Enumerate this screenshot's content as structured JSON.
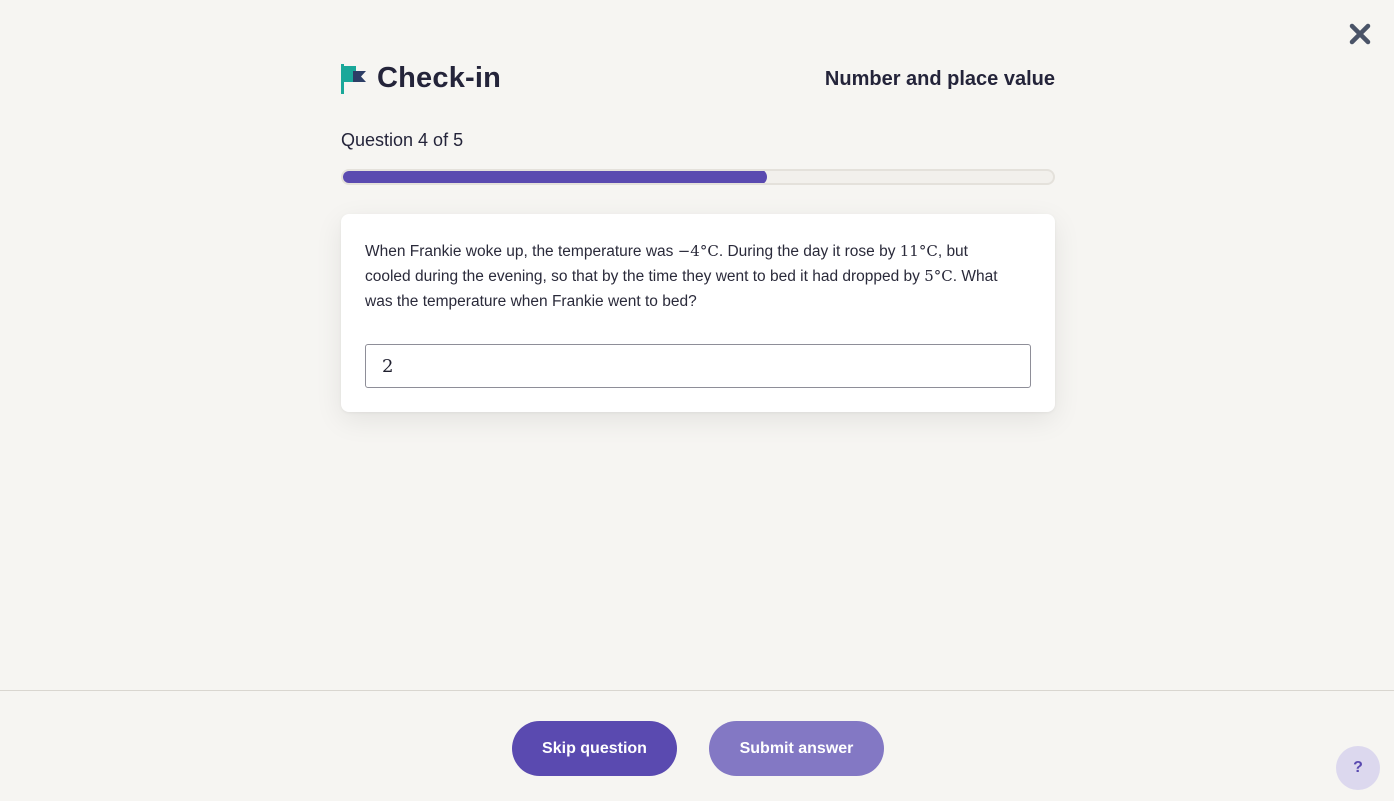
{
  "header": {
    "title": "Check-in",
    "topic": "Number and place value"
  },
  "progress": {
    "counter_text": "Question 4 of 5",
    "fraction": 0.6
  },
  "question": {
    "text_part1": "When Frankie woke up, the temperature was ",
    "math1": "−4°C",
    "text_part2": ". During the day it rose by ",
    "math2": "11°C",
    "text_part3": ", but cooled during the evening, so that by the time they went to bed it had dropped by ",
    "math3": "5°C",
    "text_part4": ". What was the temperature when Frankie went to bed?"
  },
  "answer": {
    "value": "2"
  },
  "footer": {
    "skip_label": "Skip question",
    "submit_label": "Submit answer",
    "help_label": "?"
  },
  "icons": {
    "close": "close-icon",
    "flag": "flag-icon",
    "help": "question-mark-icon"
  },
  "colors": {
    "accent": "#5a4ab0",
    "accent_light": "#8378c4",
    "flag_teal": "#1aa89a",
    "flag_navy": "#2d3e66",
    "background": "#f6f5f2"
  }
}
